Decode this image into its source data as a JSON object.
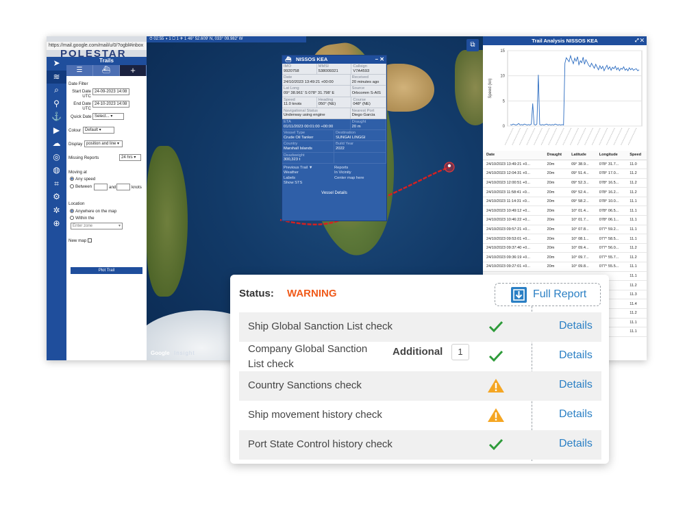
{
  "browser": {
    "url": "https://mail.google.com/mail/u/0/?ogbl#inbox"
  },
  "app": {
    "logo_text": "POLESTAR"
  },
  "trails": {
    "title": "Trails",
    "date_filter_label": "Date Filter",
    "start_date_label": "Start Date UTC",
    "start_date_value": "24-09-2023 14:08",
    "end_date_label": "End Date UTC",
    "end_date_value": "24-10-2023 14:08",
    "quick_date_label": "Quick Date",
    "quick_date_value": "Select...",
    "colour_label": "Colour",
    "colour_value": "Default",
    "display_label": "Display",
    "display_value": "position and line",
    "missing_reports_label": "Missing Reports",
    "missing_reports_value": "24 hrs",
    "moving_at_label": "Moving at",
    "any_speed_label": "Any speed",
    "between_label": "Between",
    "and_label": "and",
    "knots_label": "knots",
    "location_label": "Location",
    "anywhere_label": "Anywhere on the map",
    "within_label": "Within the",
    "zone_placeholder": "Enter zone",
    "new_map_label": "New map",
    "plot_label": "Plot Trail"
  },
  "map": {
    "toolbar": "⏱ 02:55    ◑ 1  ▢ 1  ✈ 1    46° 52.609' N, 033° 09.982' W",
    "google_label": "Google",
    "insight_label": "Insight"
  },
  "vessel": {
    "name": "NISSOS KEA",
    "imo_label": "IMO",
    "imo": "9920758",
    "mmsi_label": "MMSI",
    "mmsi": "538009321",
    "callsign_label": "Callsign",
    "callsign": "V7A4593",
    "date_label": "Date",
    "date": "24/10/2023 13:49:21 +00:00",
    "received_label": "Received",
    "received": "20 minutes ago",
    "latlong_label": "Lat Long",
    "latlong": "09° 38.961' S 078° 31.798' E",
    "source_label": "Source",
    "source": "Orbcomm S-AIS",
    "speed_label": "Speed",
    "speed": "11.0 knots",
    "heading_label": "Heading",
    "heading": "050° (NE)",
    "course_label": "Course",
    "course": "048° (NE)",
    "navstatus_label": "Navigational Status",
    "navstatus": "Underway using engine",
    "nearest_port_label": "Nearest Port",
    "nearest_port": "Diego Garcia",
    "eta_label": "ETA",
    "eta": "01/11/2023 00:01:00 +00:00",
    "draught_label": "Draught",
    "draught": "20 m",
    "vessel_type_label": "Vessel Type",
    "vessel_type": "Crude Oil Tanker",
    "destination_label": "Destination",
    "destination": "SUNGAI LINGGI",
    "country_label": "Country",
    "country": "Marshall Islands",
    "build_year_label": "Build Year",
    "build_year": "2022",
    "deadweight_label": "Deadweight",
    "deadweight": "300,323 t",
    "links_left": [
      "Previous Trail ▼",
      "Weather",
      "Labels",
      "Show STS"
    ],
    "links_right": [
      "Reports",
      "In Vicinity",
      "Center map here"
    ],
    "details_label": "Vessel Details"
  },
  "analysis": {
    "title": "Trail Analysis NISSOS KEA",
    "columns": [
      "Date",
      "Draught",
      "Latitude",
      "Longitude",
      "Speed"
    ],
    "rows": [
      [
        "24/10/2023 13:49:21 +0...",
        "20m",
        "09° 38.9...",
        "078° 31.7...",
        "11.0"
      ],
      [
        "24/10/2023 12:04:31 +0...",
        "20m",
        "09° 51.4...",
        "078° 17.0...",
        "11.2"
      ],
      [
        "24/10/2023 12:00:51 +0...",
        "20m",
        "09° 52.3...",
        "078° 16.5...",
        "11.2"
      ],
      [
        "24/10/2023 11:58:41 +0...",
        "20m",
        "09° 52.4...",
        "078° 16.2...",
        "11.2"
      ],
      [
        "24/10/2023 11:14:31 +0...",
        "20m",
        "09° 58.2...",
        "078° 10.0...",
        "11.1"
      ],
      [
        "24/10/2023 10:49:12 +0...",
        "20m",
        "10° 01.4...",
        "078° 06.5...",
        "11.1"
      ],
      [
        "24/10/2023 10:46:22 +0...",
        "20m",
        "10° 01.7...",
        "078° 06.1...",
        "11.1"
      ],
      [
        "24/10/2023 09:57:21 +0...",
        "20m",
        "10° 07.8...",
        "077° 59.2...",
        "11.1"
      ],
      [
        "24/10/2023 09:53:01 +0...",
        "20m",
        "10° 08.1...",
        "077° 58.5...",
        "11.1"
      ],
      [
        "24/10/2023 09:37:40 +0...",
        "20m",
        "10° 09.4...",
        "077° 56.0...",
        "11.2"
      ],
      [
        "24/10/2023 09:36:19 +0...",
        "20m",
        "10° 09.7...",
        "077° 55.7...",
        "11.2"
      ],
      [
        "24/10/2023 09:27:01 +0...",
        "20m",
        "10° 09.8...",
        "077° 55.5...",
        "11.1"
      ],
      [
        "",
        "",
        "",
        "",
        "11.1"
      ],
      [
        "",
        "",
        "",
        "",
        "11.2"
      ],
      [
        "",
        "",
        "",
        "",
        "11.3"
      ],
      [
        "",
        "",
        "",
        "",
        "11.4"
      ],
      [
        "",
        "",
        "",
        "",
        "11.2"
      ],
      [
        "",
        "",
        "",
        "",
        "11.1"
      ],
      [
        "",
        "",
        "",
        "",
        "11.1"
      ]
    ]
  },
  "chart_data": {
    "type": "line",
    "title": "",
    "xlabel": "",
    "ylabel": "Speed (kn)",
    "ylim": [
      0,
      15
    ],
    "yticks": [
      0,
      5,
      10,
      15
    ],
    "grid": true,
    "legend": "none",
    "series": [
      {
        "values": [
          0.3,
          0.2,
          0.4,
          0.3,
          0.2,
          0.3,
          0.5,
          0.2,
          0.3,
          0.2,
          0.4,
          0.3,
          0.2,
          0.3,
          0.2,
          0.4,
          4.5,
          0.3,
          0.2,
          0.4,
          10.2,
          0.3,
          0.2,
          0.3,
          0.2,
          0.3,
          0.4,
          0.2,
          0.3,
          0.2,
          0.3,
          0.2,
          0.4,
          0.3,
          0.2,
          0.3,
          0.2,
          0.3,
          0.2,
          12.5,
          13.6,
          13.2,
          12.8,
          14.0,
          13.1,
          12.4,
          13.5,
          12.9,
          13.8,
          12.2,
          13.0,
          12.6,
          13.7,
          12.3,
          13.2,
          12.7,
          12.1,
          11.8,
          12.5,
          12.0,
          11.5,
          12.3,
          11.7,
          11.2,
          12.0,
          11.4,
          11.9,
          11.0,
          11.6,
          12.1,
          11.3,
          11.8,
          11.1,
          11.7,
          11.4,
          11.9,
          11.2,
          11.6,
          11.0,
          11.5,
          11.3,
          11.8,
          11.1,
          11.4,
          11.0,
          11.6,
          11.2,
          11.5,
          11.1,
          11.3,
          11.4,
          11.0,
          11.2
        ]
      }
    ]
  },
  "report": {
    "status_label": "Status:",
    "status_value": "WARNING",
    "full_report_label": "Full Report",
    "additional_label": "Additional",
    "additional_count": "1",
    "checks": [
      {
        "name": "Ship Global Sanction List check",
        "result": "pass",
        "link": "Details"
      },
      {
        "name": "Company Global Sanction\nList check",
        "result": "pass",
        "link": "Details"
      },
      {
        "name": "Country Sanctions check",
        "result": "warning",
        "link": "Details"
      },
      {
        "name": "Ship movement history check",
        "result": "warning",
        "link": "Details"
      },
      {
        "name": "Port State Control history check",
        "result": "pass",
        "link": "Details"
      }
    ],
    "colors": {
      "warning": "#f05a1a",
      "pass": "#2e9b3a",
      "warn_icon": "#f5a623",
      "link": "#2a7fc4"
    }
  }
}
